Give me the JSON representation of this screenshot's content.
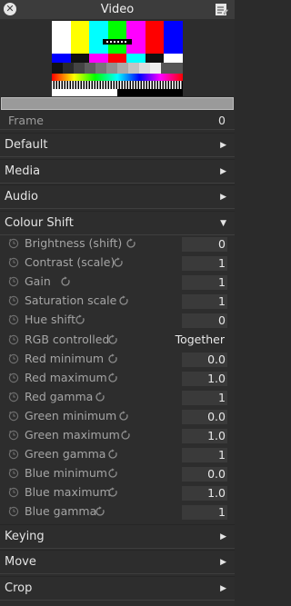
{
  "window": {
    "title": "Video"
  },
  "frame": {
    "label": "Frame",
    "value": "0"
  },
  "sections_top": [
    {
      "label": "Default"
    },
    {
      "label": "Media"
    },
    {
      "label": "Audio"
    },
    {
      "label": "Colour Shift"
    }
  ],
  "colour_shift": [
    {
      "label": "Brightness (shift)",
      "value": "0"
    },
    {
      "label": "Contrast (scale)",
      "value": "1"
    },
    {
      "label": "Gain",
      "value": "1"
    },
    {
      "label": "Saturation scale",
      "value": "1"
    },
    {
      "label": "Hue shift",
      "value": "0"
    },
    {
      "label": "RGB controlled",
      "value": "Together"
    },
    {
      "label": "Red minimum",
      "value": "0.0"
    },
    {
      "label": "Red maximum",
      "value": "1.0"
    },
    {
      "label": "Red gamma",
      "value": "1"
    },
    {
      "label": "Green minimum",
      "value": "0.0"
    },
    {
      "label": "Green maximum",
      "value": "1.0"
    },
    {
      "label": "Green gamma",
      "value": "1"
    },
    {
      "label": "Blue minimum",
      "value": "0.0"
    },
    {
      "label": "Blue maximum",
      "value": "1.0"
    },
    {
      "label": "Blue gamma",
      "value": "1"
    }
  ],
  "sections_bottom": [
    {
      "label": "Keying"
    },
    {
      "label": "Move"
    },
    {
      "label": "Crop"
    }
  ],
  "icons": {
    "close": "close-icon",
    "edit": "edit-notes-icon",
    "expand": "triangle-right-icon",
    "collapse": "triangle-down-icon",
    "keyframe": "clock-icon",
    "reset": "reset-icon"
  },
  "colors": {
    "panel_bg": "#2d2d2d",
    "titlebar_bg": "#3c3c3c",
    "value_bg": "#3a3a3a",
    "scrub_bar": "#9a9a9a"
  }
}
